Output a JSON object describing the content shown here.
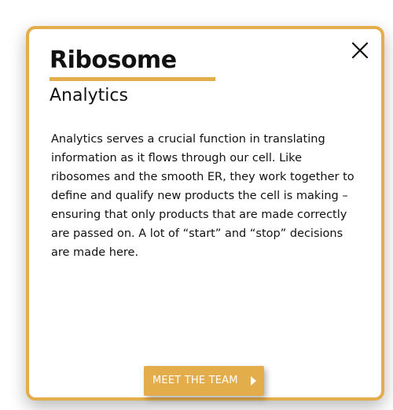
{
  "card": {
    "title": "Ribosome",
    "subtitle": "Analytics",
    "description": "Analytics serves a crucial function in translating information as it flows through our cell. Like ribosomes and the smooth ER, they work together to define and qualify new products the cell is making – ensuring that only products that are made correctly are passed on. A lot of “start” and “stop” decisions are made here.",
    "close_icon": "close-icon",
    "button_label": "MEET THE TEAM",
    "button_icon": "play-triangle-icon"
  },
  "colors": {
    "accent": "#e4ad4c",
    "text": "#111111",
    "background": "#ffffff"
  }
}
